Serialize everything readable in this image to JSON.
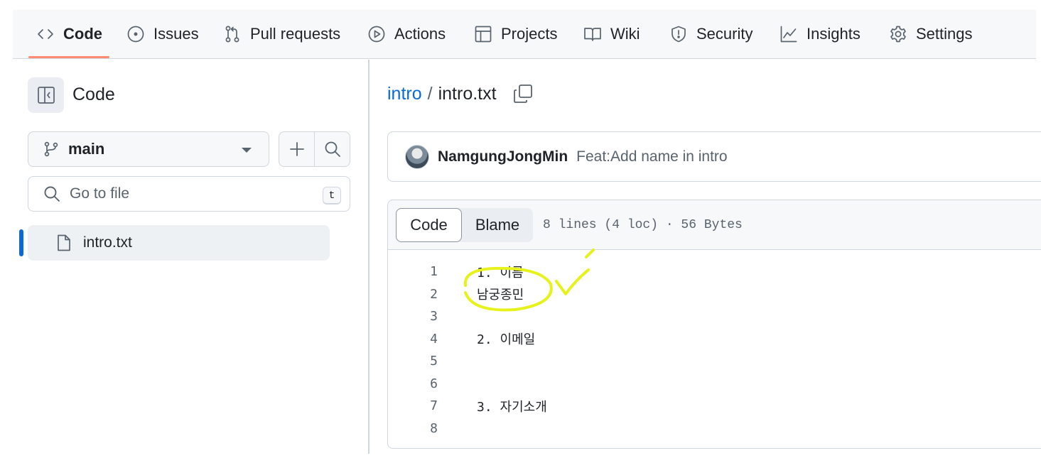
{
  "repo_nav": {
    "tabs": [
      {
        "label": "Code",
        "icon": "code-icon",
        "active": true
      },
      {
        "label": "Issues",
        "icon": "issue-opened-icon"
      },
      {
        "label": "Pull requests",
        "icon": "git-pull-request-icon"
      },
      {
        "label": "Actions",
        "icon": "play-icon"
      },
      {
        "label": "Projects",
        "icon": "table-icon"
      },
      {
        "label": "Wiki",
        "icon": "book-icon"
      },
      {
        "label": "Security",
        "icon": "shield-icon"
      },
      {
        "label": "Insights",
        "icon": "graph-icon"
      },
      {
        "label": "Settings",
        "icon": "gear-icon"
      }
    ]
  },
  "sidebar": {
    "title": "Code",
    "branch": "main",
    "search": {
      "placeholder": "Go to file",
      "shortcut": "t"
    },
    "files": [
      {
        "name": "intro.txt",
        "icon": "file-icon",
        "selected": true
      }
    ]
  },
  "breadcrumb": {
    "repo": "intro",
    "separator": "/",
    "file": "intro.txt"
  },
  "commit": {
    "author": "NamgungJongMin",
    "message": "Feat:Add name in intro"
  },
  "file_view": {
    "tabs": [
      "Code",
      "Blame"
    ],
    "active_tab": "Code",
    "meta": "8 lines (4 loc) · 56 Bytes",
    "lines": [
      {
        "num": "1",
        "text": "1. 이름"
      },
      {
        "num": "2",
        "text": "남궁종민"
      },
      {
        "num": "3",
        "text": ""
      },
      {
        "num": "4",
        "text": "2. 이메일"
      },
      {
        "num": "5",
        "text": ""
      },
      {
        "num": "6",
        "text": ""
      },
      {
        "num": "7",
        "text": "3. 자기소개"
      },
      {
        "num": "8",
        "text": ""
      }
    ]
  },
  "colors": {
    "accent": "#0969da",
    "tab_underline": "#fd8c73",
    "annotation": "#e6f21a"
  }
}
